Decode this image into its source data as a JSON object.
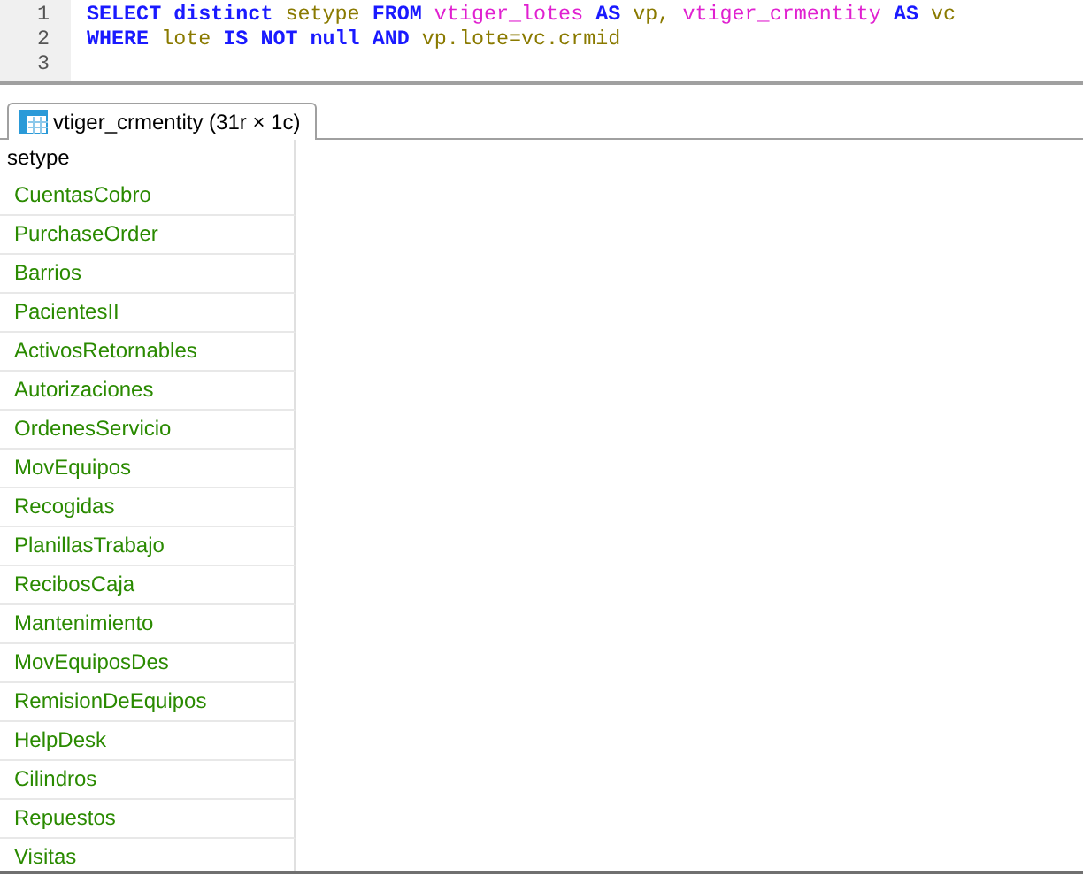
{
  "editor": {
    "lines": [
      {
        "number": "1",
        "tokens": [
          {
            "kind": "keyword",
            "text": "SELECT distinct"
          },
          {
            "kind": "ident",
            "text": "setype"
          },
          {
            "kind": "keyword",
            "text": "FROM"
          },
          {
            "kind": "table",
            "text": "vtiger_lotes"
          },
          {
            "kind": "keyword",
            "text": "AS"
          },
          {
            "kind": "ident",
            "text": "vp,"
          },
          {
            "kind": "table",
            "text": "vtiger_crmentity"
          },
          {
            "kind": "keyword",
            "text": "AS"
          },
          {
            "kind": "ident",
            "text": "vc"
          }
        ]
      },
      {
        "number": "2",
        "tokens": [
          {
            "kind": "keyword",
            "text": "WHERE"
          },
          {
            "kind": "ident",
            "text": "lote"
          },
          {
            "kind": "keyword",
            "text": "IS NOT null AND"
          },
          {
            "kind": "ident",
            "text": "vp.lote=vc.crmid"
          }
        ]
      },
      {
        "number": "3"
      }
    ]
  },
  "tabs": [
    {
      "label": "vtiger_crmentity (31r × 1c)",
      "selected": true
    }
  ],
  "table": {
    "columns": [
      "setype"
    ],
    "rows": [
      "CuentasCobro",
      "PurchaseOrder",
      "Barrios",
      "PacientesII",
      "ActivosRetornables",
      "Autorizaciones",
      "OrdenesServicio",
      "MovEquipos",
      "Recogidas",
      "PlanillasTrabajo",
      "RecibosCaja",
      "Mantenimiento",
      "MovEquiposDes",
      "RemisionDeEquipos",
      "HelpDesk",
      "Cilindros",
      "Repuestos",
      "Visitas"
    ]
  }
}
